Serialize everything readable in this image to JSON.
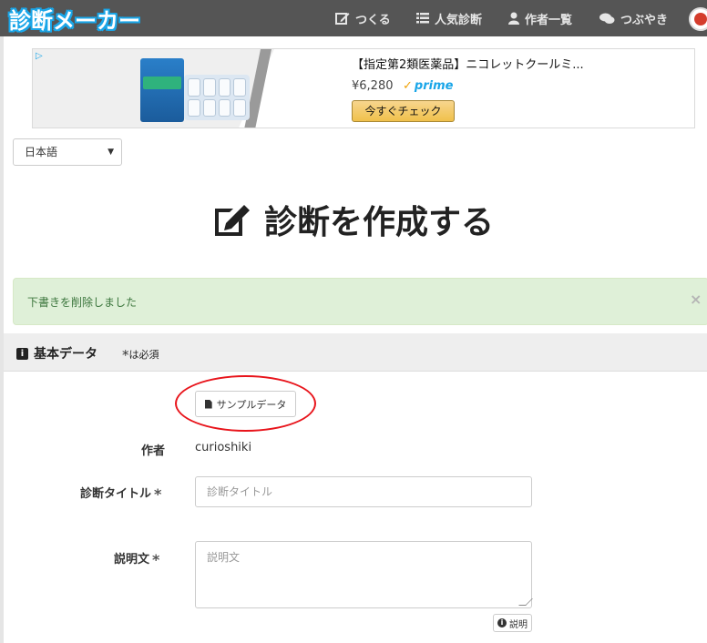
{
  "navbar": {
    "brand": "診断メーカー",
    "links": [
      {
        "label": "つくる",
        "icon": "edit-icon"
      },
      {
        "label": "人気診断",
        "icon": "list-icon"
      },
      {
        "label": "作者一覧",
        "icon": "user-icon"
      },
      {
        "label": "つぶやき",
        "icon": "comments-icon"
      }
    ]
  },
  "ad": {
    "title": "【指定第2類医薬品】ニコレットクールミ...",
    "price": "¥6,280",
    "prime": "prime",
    "button": "今すぐチェック"
  },
  "language": {
    "selected": "日本語"
  },
  "page": {
    "heading": "診断を作成する"
  },
  "alert": {
    "message": "下書きを削除しました",
    "close": "×"
  },
  "section": {
    "title": "基本データ",
    "required_note": "は必須"
  },
  "form": {
    "sample_button": "サンプルデータ",
    "author_label": "作者",
    "author_value": "curioshiki",
    "title_label": "診断タイトル",
    "title_placeholder": "診断タイトル",
    "description_label": "説明文",
    "description_placeholder": "説明文",
    "help_button": "説明"
  },
  "colors": {
    "navbar": "#555555",
    "brand_outline": "#1aa6e8",
    "alert_bg": "#dff0d8",
    "annotation": "#e8141b"
  }
}
